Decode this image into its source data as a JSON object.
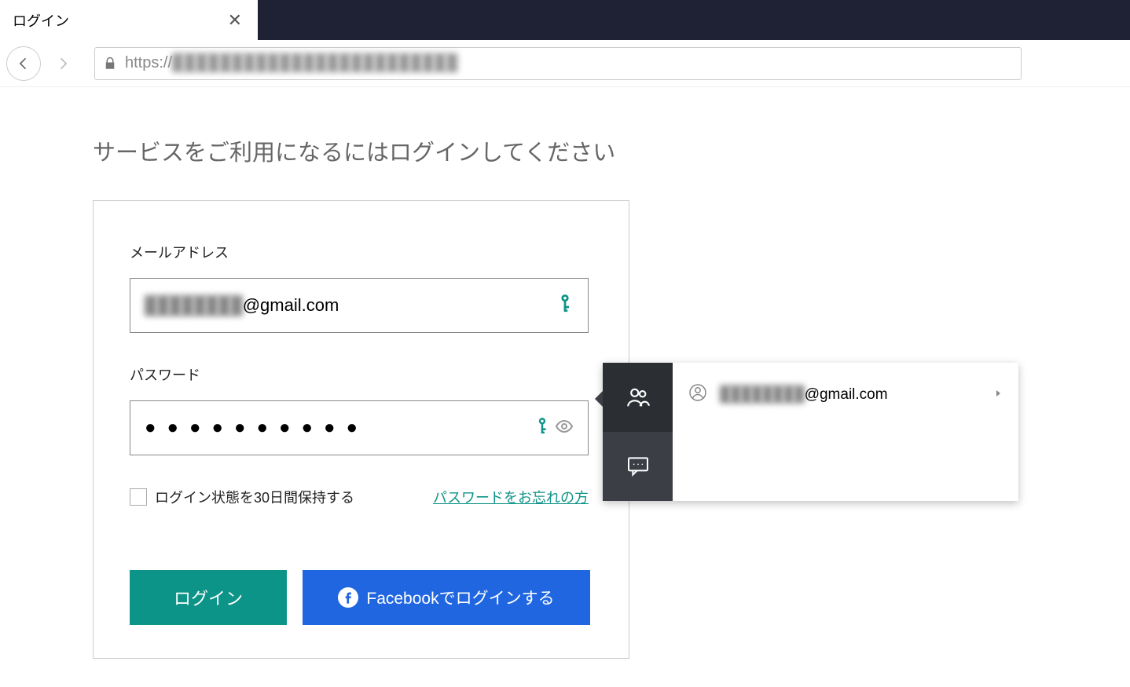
{
  "browser": {
    "tab_title": "ログイン",
    "url_scheme": "https://",
    "url_rest_masked": "████████████████████████"
  },
  "page": {
    "heading": "サービスをご利用になるにはログインしてください",
    "email_label": "メールアドレス",
    "email_value_masked": "████████",
    "email_domain": "@gmail.com",
    "password_label": "パスワード",
    "password_mask": "●●●●●●●●●●",
    "remember_label": "ログイン状態を30日間保持する",
    "forgot_label": "パスワードをお忘れの方",
    "login_button": "ログイン",
    "facebook_button": "Facebookでログインする"
  },
  "popup": {
    "account_email_masked": "████████",
    "account_email_domain": "@gmail.com"
  },
  "colors": {
    "brand_teal": "#0d9488",
    "facebook_blue": "#1f66e0",
    "tabstrip_bg": "#1f2235"
  }
}
